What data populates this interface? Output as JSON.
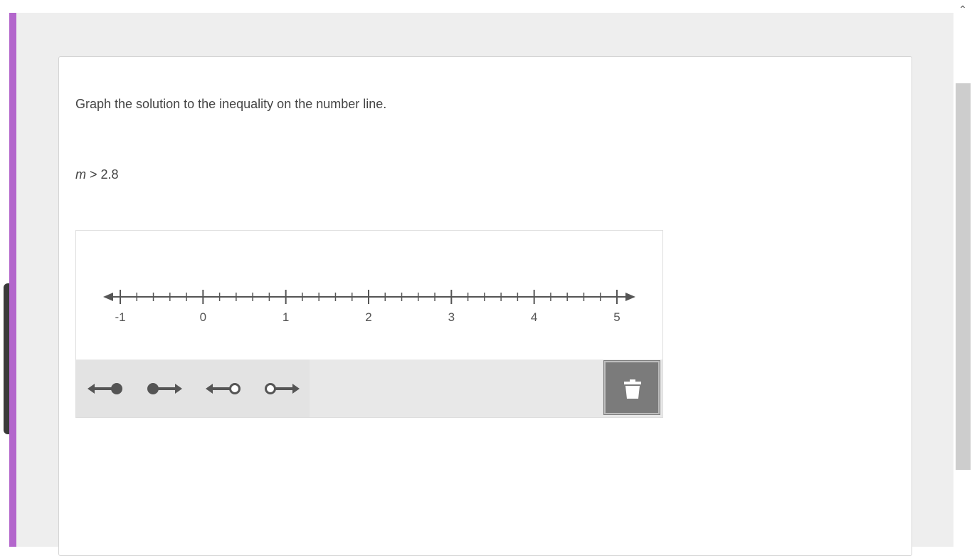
{
  "question": {
    "prompt": "Graph the solution to the inequality on the number line.",
    "inequality_var": "m",
    "inequality_rest": " > 2.8"
  },
  "number_line": {
    "min": -1,
    "max": 5,
    "minor_step": 0.2,
    "labels": [
      "-1",
      "0",
      "1",
      "2",
      "3",
      "4",
      "5"
    ]
  },
  "tools": [
    {
      "name": "closed-left-ray",
      "icon": "ray-left-closed-icon"
    },
    {
      "name": "closed-right-ray",
      "icon": "ray-right-closed-icon"
    },
    {
      "name": "open-left-ray",
      "icon": "ray-left-open-icon"
    },
    {
      "name": "open-right-ray",
      "icon": "ray-right-open-icon"
    }
  ],
  "trash": {
    "icon": "trash-icon"
  },
  "colors": {
    "accent_purple": "#b366cc",
    "line": "#555555",
    "toolbar": "#e8e8e8",
    "trash_button": "#7b7b7b"
  }
}
